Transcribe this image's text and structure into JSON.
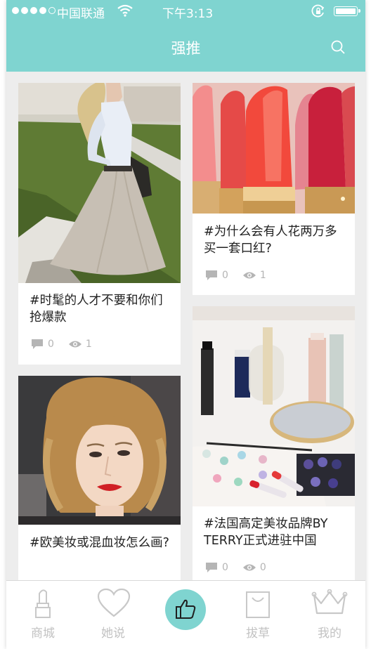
{
  "status_bar": {
    "carrier": "中国联通",
    "time": "下午3:13"
  },
  "nav": {
    "title": "强推"
  },
  "cards": [
    {
      "title": "#时髦的人才不要和你们抢爆款",
      "comments": "0",
      "views": "1"
    },
    {
      "title": "#为什么会有人花两万多买一套口红?",
      "comments": "0",
      "views": "1"
    },
    {
      "title": "#欧美妆或混血妆怎么画?",
      "comments": "",
      "views": ""
    },
    {
      "title": "#法国高定美妆品牌BY TERRY正式进驻中国",
      "comments": "0",
      "views": "0"
    }
  ],
  "tabs": [
    {
      "label": "商城",
      "icon": "lipstick-icon"
    },
    {
      "label": "她说",
      "icon": "heart-icon"
    },
    {
      "label": "",
      "icon": "thumbs-up-icon"
    },
    {
      "label": "拔草",
      "icon": "shopping-bag-icon"
    },
    {
      "label": "我的",
      "icon": "crown-icon"
    }
  ],
  "colors": {
    "accent": "#7fd4d0",
    "background": "#ededed",
    "meta_gray": "#b5b5b5",
    "tab_gray": "#c2c2c2"
  }
}
